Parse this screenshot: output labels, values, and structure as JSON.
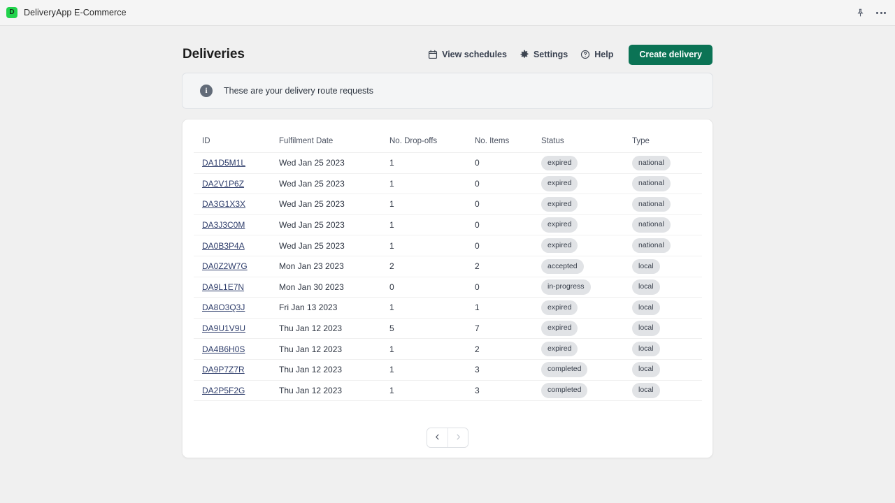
{
  "titlebar": {
    "app_name": "DeliveryApp E-Commerce",
    "logo_letter": "D",
    "logo_color": "#22d34c",
    "pin_icon": "pin-icon",
    "more_icon": "more-options-icon"
  },
  "header": {
    "title": "Deliveries",
    "links": [
      {
        "label": "View schedules",
        "icon": "calendar-icon"
      },
      {
        "label": "Settings",
        "icon": "gear-icon"
      },
      {
        "label": "Help",
        "icon": "help-circle-icon"
      }
    ],
    "primary_button": "Create delivery",
    "primary_color": "#0b7355"
  },
  "banner": {
    "icon": "info-icon",
    "text": "These are your delivery route requests"
  },
  "table": {
    "columns": [
      "ID",
      "Fulfilment Date",
      "No. Drop-offs",
      "No. Items",
      "Status",
      "Type"
    ],
    "rows": [
      {
        "id": "DA1D5M1L",
        "date": "Wed Jan 25 2023",
        "dropoffs": "1",
        "items": "0",
        "status": "expired",
        "type": "national"
      },
      {
        "id": "DA2V1P6Z",
        "date": "Wed Jan 25 2023",
        "dropoffs": "1",
        "items": "0",
        "status": "expired",
        "type": "national"
      },
      {
        "id": "DA3G1X3X",
        "date": "Wed Jan 25 2023",
        "dropoffs": "1",
        "items": "0",
        "status": "expired",
        "type": "national"
      },
      {
        "id": "DA3J3C0M",
        "date": "Wed Jan 25 2023",
        "dropoffs": "1",
        "items": "0",
        "status": "expired",
        "type": "national"
      },
      {
        "id": "DA0B3P4A",
        "date": "Wed Jan 25 2023",
        "dropoffs": "1",
        "items": "0",
        "status": "expired",
        "type": "national"
      },
      {
        "id": "DA0Z2W7G",
        "date": "Mon Jan 23 2023",
        "dropoffs": "2",
        "items": "2",
        "status": "accepted",
        "type": "local"
      },
      {
        "id": "DA9L1E7N",
        "date": "Mon Jan 30 2023",
        "dropoffs": "0",
        "items": "0",
        "status": "in-progress",
        "type": "local"
      },
      {
        "id": "DA8O3Q3J",
        "date": "Fri Jan 13 2023",
        "dropoffs": "1",
        "items": "1",
        "status": "expired",
        "type": "local"
      },
      {
        "id": "DA9U1V9U",
        "date": "Thu Jan 12 2023",
        "dropoffs": "5",
        "items": "7",
        "status": "expired",
        "type": "local"
      },
      {
        "id": "DA4B6H0S",
        "date": "Thu Jan 12 2023",
        "dropoffs": "1",
        "items": "2",
        "status": "expired",
        "type": "local"
      },
      {
        "id": "DA9P7Z7R",
        "date": "Thu Jan 12 2023",
        "dropoffs": "1",
        "items": "3",
        "status": "completed",
        "type": "local"
      },
      {
        "id": "DA2P5F2G",
        "date": "Thu Jan 12 2023",
        "dropoffs": "1",
        "items": "3",
        "status": "completed",
        "type": "local"
      }
    ]
  },
  "pagination": {
    "prev_icon": "chevron-left-icon",
    "next_icon": "chevron-right-icon"
  }
}
